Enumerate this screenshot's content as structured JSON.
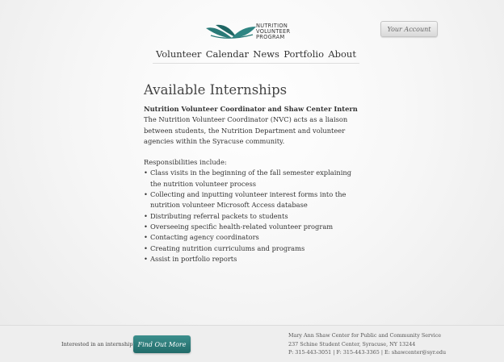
{
  "header": {
    "logo_lines": [
      "NUTRITION",
      "VOLUNTEER",
      "PROGRAM"
    ],
    "account_button": "Your Account",
    "brand_color": "#2a7a78"
  },
  "nav": {
    "items": [
      "Volunteer",
      "Calendar",
      "News",
      "Portfolio",
      "About"
    ]
  },
  "main": {
    "title": "Available Internships",
    "job_title": "Nutrition Volunteer Coordinator and Shaw Center Intern",
    "description": "The Nutrition Volunteer Coordinator (NVC) acts as a liaison between students, the Nutrition Department and volunteer agencies within the Syracuse community.",
    "responsibilities_heading": "Responsibilities include:",
    "responsibilities": [
      "Class visits in the beginning of the fall semester explaining the nutrition volunteer process",
      "Collecting and inputting volunteer interest forms into the nutrition volunteer Microsoft Access database",
      "Distributing referral packets to students",
      "Overseeing specific health-related volunteer program",
      "Contacting agency coordinators",
      "Creating nutrition curriculums and programs",
      "Assist in portfolio reports"
    ]
  },
  "footer": {
    "question": "Interested in an internship?",
    "button": "Find Out More",
    "address_lines": [
      "Mary Ann Shaw Center for Public and Community Service",
      "237 Schine Student Center, Syracuse, NY 13244",
      "P: 315-443-3051 | F: 315-443-3365 | E: shawcenter@syr.edu"
    ]
  }
}
